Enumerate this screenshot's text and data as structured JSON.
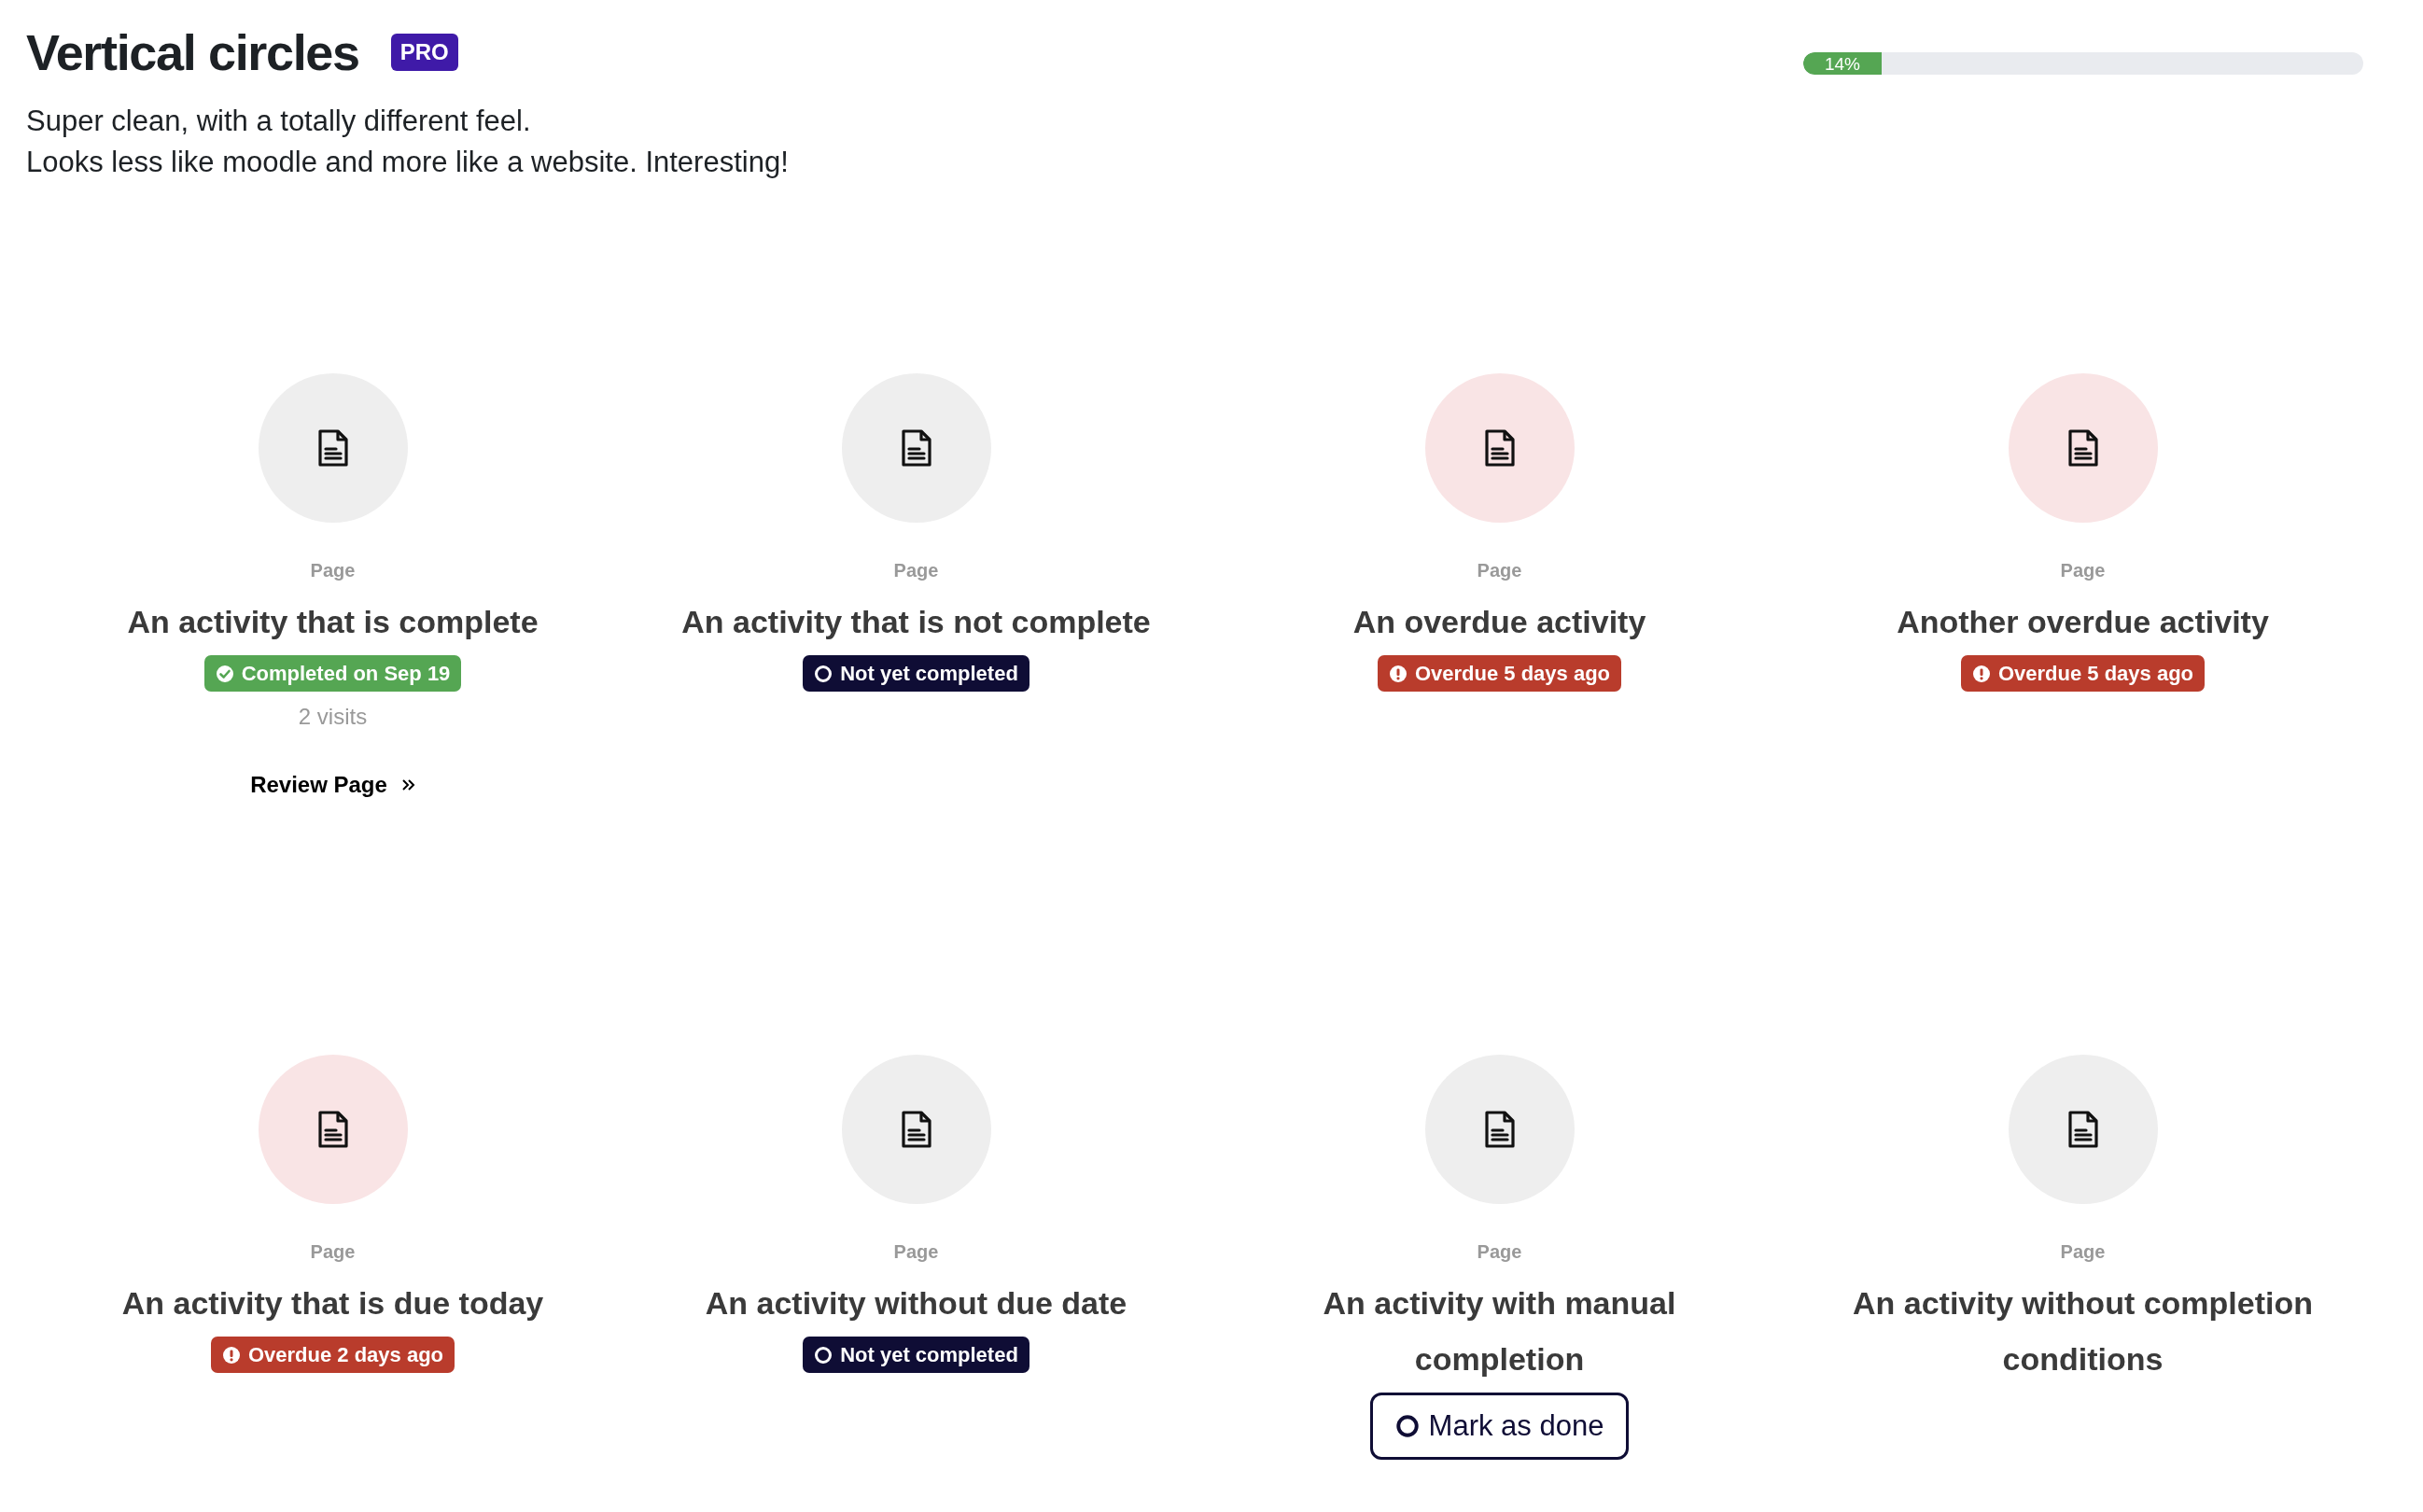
{
  "header": {
    "title": "Vertical circles",
    "badge": "PRO",
    "description": [
      "Super clean, with a totally different feel.",
      "Looks less like moodle and more like a website. Interesting!"
    ]
  },
  "progress": {
    "level": 0.14,
    "reading": "14%"
  },
  "activities": [
    {
      "type": "Page",
      "name": "An activity that is complete",
      "status": {
        "kind": "completed",
        "label": "Completed on Sep 19"
      },
      "visits": "2 visits",
      "link": "Review Page"
    },
    {
      "type": "Page",
      "name": "An activity that is not complete",
      "status": {
        "kind": "pending",
        "label": "Not yet completed"
      }
    },
    {
      "type": "Page",
      "name": "An overdue activity",
      "status": {
        "kind": "overdue",
        "label": "Overdue 5 days ago"
      }
    },
    {
      "type": "Page",
      "name": "Another overdue activity",
      "status": {
        "kind": "overdue",
        "label": "Overdue 5 days ago"
      }
    },
    {
      "type": "Page",
      "name": "An activity that is due today",
      "status": {
        "kind": "overdue",
        "label": "Overdue 2 days ago"
      }
    },
    {
      "type": "Page",
      "name": "An activity without due date",
      "status": {
        "kind": "pending",
        "label": "Not yet completed"
      }
    },
    {
      "type": "Page",
      "name": "An activity with manual completion",
      "status": {
        "kind": "manual",
        "label": "Mark as done"
      }
    },
    {
      "type": "Page",
      "name": "An activity without completion conditions"
    }
  ]
}
